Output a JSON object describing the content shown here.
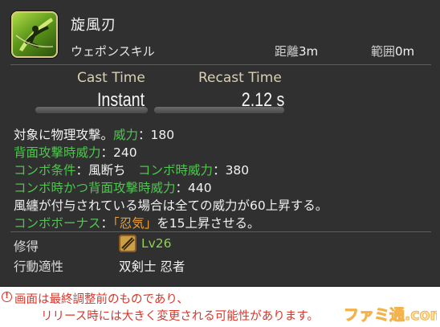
{
  "skill": {
    "name": "旋風刃",
    "type": "ウェポンスキル",
    "distance_label": "距離",
    "distance_value": "3m",
    "range_label": "範囲",
    "range_value": "0m"
  },
  "timing": {
    "cast_label": "Cast Time",
    "cast_value": "Instant",
    "recast_label": "Recast Time",
    "recast_value": "2.12 s"
  },
  "description": {
    "l1_a": "対象に物理攻撃。",
    "l1_label": "威力",
    "l1_b": "：180",
    "l2_label": "背面攻撃時威力",
    "l2_b": "：240",
    "l3_label": "コンボ条件",
    "l3_b": "：風断ち",
    "l3_label2": "コンボ時威力",
    "l3_c": "：380",
    "l4_label": "コンボ時かつ背面攻撃時威力",
    "l4_b": "：440",
    "l5": "風纏が付与されている場合は全ての威力が60上昇する。",
    "l6_label": "コンボボーナス",
    "l6_b": "：",
    "l6_status": "「忍気」",
    "l6_c": "を15上昇させる。"
  },
  "info": {
    "acquire_label": "修得",
    "job_icon": "ninja-job-icon",
    "level": "Lv26",
    "class_label": "行動適性",
    "classes": "双剣士 忍者"
  },
  "notice": {
    "icon": "exclamation-icon",
    "line1": "画面は最終調整前のものであり、",
    "line2": "リリース時には大きく変更される可能性があります。"
  },
  "watermark": "ファミ通.com",
  "colors": {
    "background": "#303030",
    "highlight_green": "#4ec64e",
    "highlight_orange": "#f0a030",
    "notice_red": "#d9372b"
  }
}
